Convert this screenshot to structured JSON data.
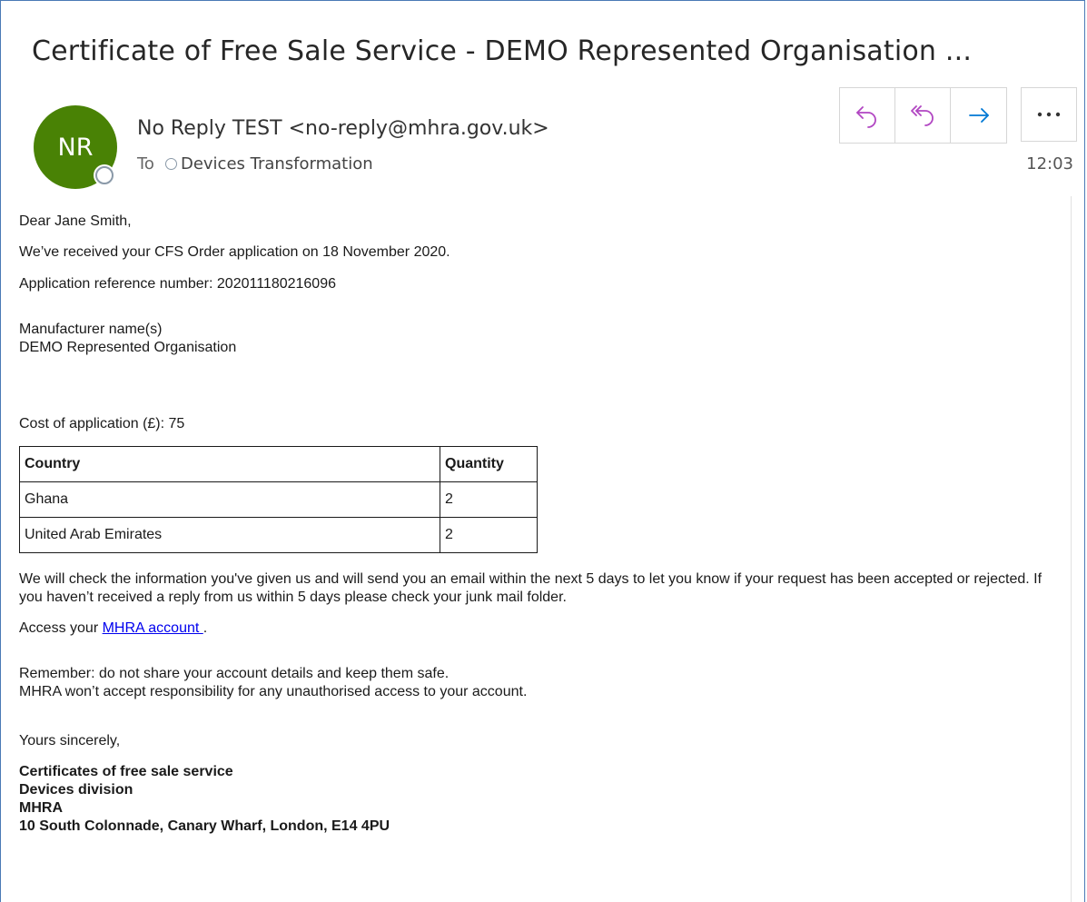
{
  "email": {
    "subject": "Certificate of Free Sale Service - DEMO Represented Organisation ...",
    "avatar_initials": "NR",
    "sender": "No Reply TEST <no-reply@mhra.gov.uk>",
    "to_label": "To",
    "recipient": "Devices Transformation",
    "time": "12:03",
    "actions": {
      "reply": "reply-icon",
      "reply_all": "reply-all-icon",
      "forward": "forward-icon",
      "more": "more-icon"
    },
    "colors": {
      "avatar": "#498205",
      "reply_icons": "#b146c2",
      "forward_icon": "#0078d4",
      "link": "#0000ee"
    }
  },
  "body": {
    "greeting": "Dear Jane Smith,",
    "received": "We’ve received your CFS Order application on 18 November 2020.",
    "reference": "Application reference number: 202011180216096",
    "manufacturer_label": "Manufacturer name(s)",
    "manufacturer_name": "DEMO Represented Organisation",
    "cost": "Cost of application (£): 75",
    "table": {
      "headers": [
        "Country",
        "Quantity"
      ],
      "rows": [
        [
          "Ghana",
          "2"
        ],
        [
          "United Arab Emirates",
          "2"
        ]
      ]
    },
    "check_info": "We will check the information you've given us and will send you an email within the next 5 days to let you know if your request has been accepted or rejected. If you haven’t received a reply from us within 5 days please check your junk mail folder.",
    "access_prefix": "Access your ",
    "access_link": "MHRA account ",
    "access_suffix": ".",
    "remember_1": "Remember: do not share your account details and keep them safe.",
    "remember_2": "MHRA won’t accept responsibility for any unauthorised access to your account.",
    "closing": "Yours sincerely,",
    "signature": [
      "Certificates of free sale service",
      "Devices division",
      "MHRA",
      "10 South Colonnade, Canary Wharf, London, E14 4PU"
    ]
  }
}
